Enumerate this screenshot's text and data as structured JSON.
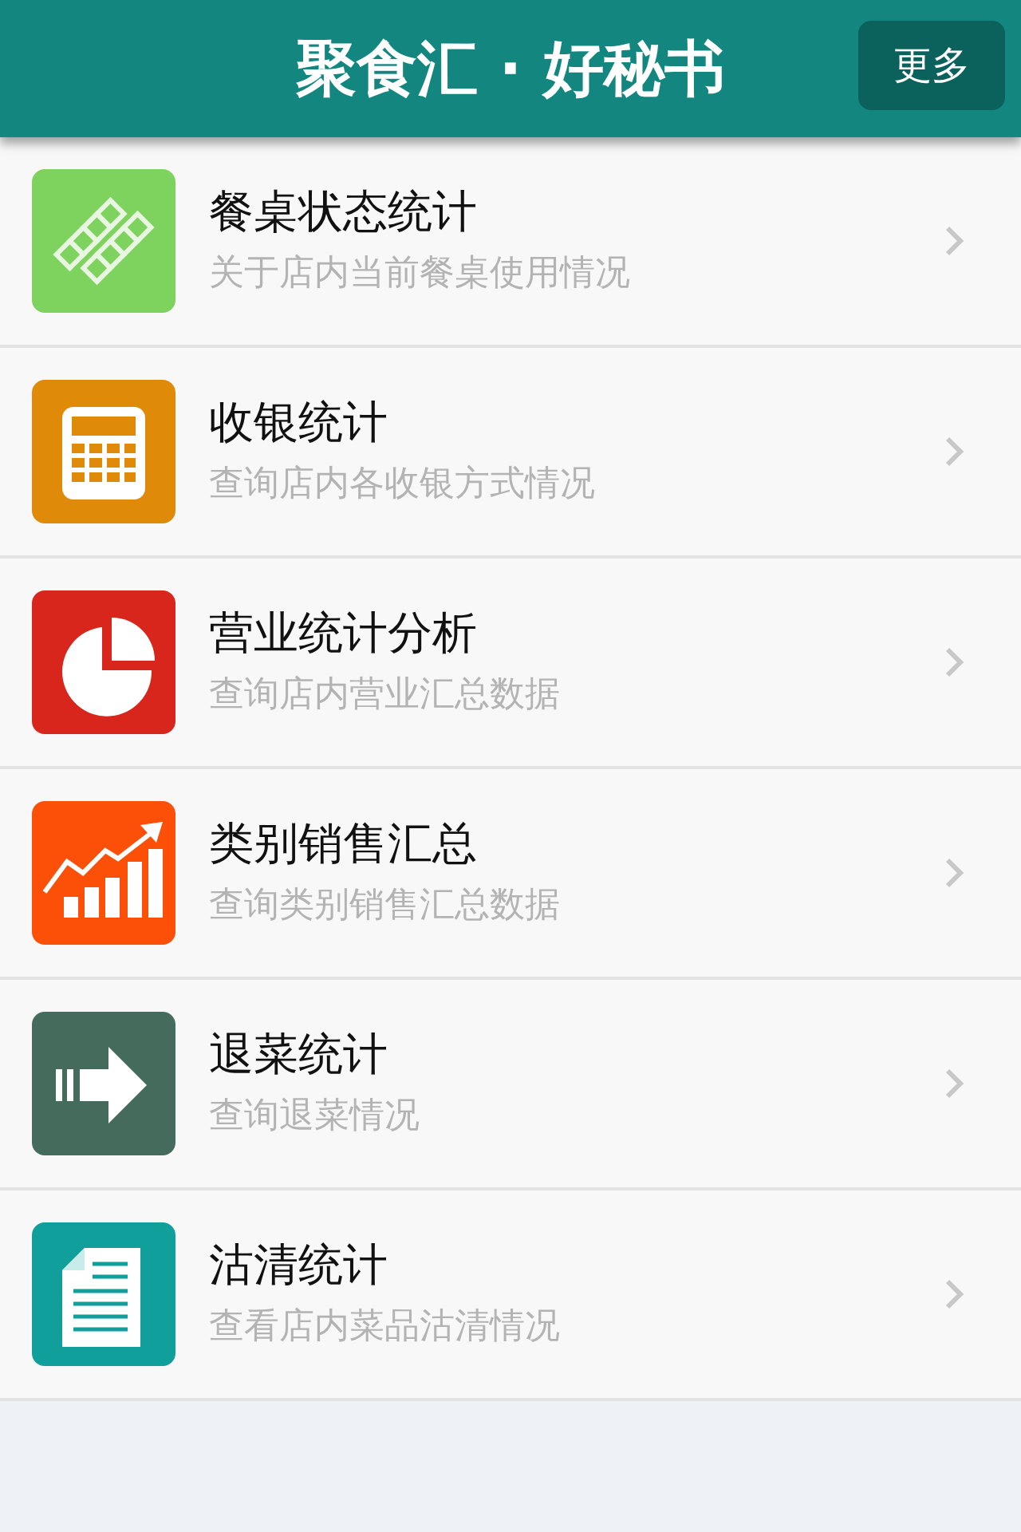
{
  "header": {
    "title": "聚食汇 · 好秘书",
    "more_button": "更多"
  },
  "items": [
    {
      "kind": "tables",
      "color": "#7ed35f",
      "title": "餐桌状态统计",
      "subtitle": "关于店内当前餐桌使用情况"
    },
    {
      "kind": "calculator",
      "color": "#e08a0a",
      "title": "收银统计",
      "subtitle": "查询店内各收银方式情况"
    },
    {
      "kind": "pie",
      "color": "#d9261c",
      "title": "营业统计分析",
      "subtitle": "查询店内营业汇总数据"
    },
    {
      "kind": "growth",
      "color": "#fc5009",
      "title": "类别销售汇总",
      "subtitle": "查询类别销售汇总数据"
    },
    {
      "kind": "arrow",
      "color": "#456b5d",
      "title": "退菜统计",
      "subtitle": "查询退菜情况"
    },
    {
      "kind": "document",
      "color": "#109f9b",
      "title": "沽清统计",
      "subtitle": "查看店内菜品沽清情况"
    }
  ]
}
